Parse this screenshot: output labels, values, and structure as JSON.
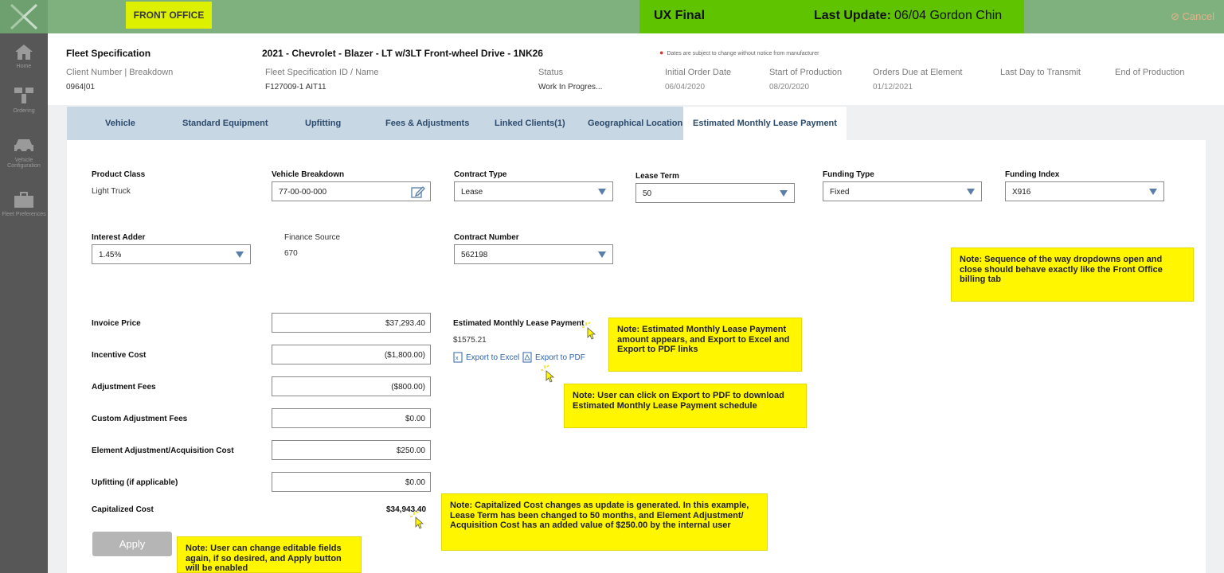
{
  "topbar": {
    "front_office": "FRONT OFFICE",
    "ux_final": "UX Final",
    "last_update_label": "Last Update:",
    "last_update_value": "06/04   Gordon Chin",
    "cancel": "Cancel"
  },
  "sidebar": {
    "items": [
      {
        "label": "Home",
        "icon": "home-icon"
      },
      {
        "label": "Ordering",
        "icon": "ordering-icon"
      },
      {
        "label": "Vehicle Configuration",
        "icon": "car-icon"
      },
      {
        "label": "Fleet Preferences",
        "icon": "briefcase-icon"
      }
    ]
  },
  "header": {
    "fleet_spec_label": "Fleet Specification",
    "vehicle_title": "2021 - Chevrolet - Blazer - LT w/3LT Front-wheel Drive - 1NK26",
    "disclaimer": "Dates are subject to change without notice from manufacturer",
    "client_label": "Client Number | Breakdown",
    "client_value": "0964|01",
    "spec_id_label": "Fleet Specification ID / Name",
    "spec_id_value": "F127009-1 AIT11",
    "status_label": "Status",
    "status_value": "Work In Progres...",
    "initial_order_label": "Initial Order Date",
    "initial_order_value": "06/04/2020",
    "start_prod_label": "Start of Production",
    "start_prod_value": "08/20/2020",
    "orders_due_label": "Orders Due at Element",
    "orders_due_value": "01/12/2021",
    "last_day_label": "Last Day to Transmit",
    "end_prod_label": "End of Production"
  },
  "tabs": [
    "Vehicle",
    "Standard Equipment",
    "Upfitting",
    "Fees & Adjustments",
    "Linked Clients(1)",
    "Geographical Location",
    "Estimated Monthly Lease Payment"
  ],
  "form": {
    "product_class_label": "Product Class",
    "product_class_value": "Light Truck",
    "vehicle_breakdown_label": "Vehicle Breakdown",
    "vehicle_breakdown_value": "77-00-00-000",
    "contract_type_label": "Contract Type",
    "contract_type_value": "Lease",
    "lease_term_label": "Lease Term",
    "lease_term_value": "50",
    "funding_type_label": "Funding Type",
    "funding_type_value": "Fixed",
    "funding_index_label": "Funding Index",
    "funding_index_value": "X916",
    "interest_adder_label": "Interest Adder",
    "interest_adder_value": "1.45%",
    "finance_source_label": "Finance Source",
    "finance_source_value": "670",
    "contract_number_label": "Contract Number",
    "contract_number_value": "562198"
  },
  "costs": {
    "invoice_price_label": "Invoice Price",
    "invoice_price_value": "$37,293.40",
    "incentive_cost_label": "Incentive Cost",
    "incentive_cost_value": "($1,800.00)",
    "adjustment_fees_label": "Adjustment Fees",
    "adjustment_fees_value": "($800.00)",
    "custom_adj_label": "Custom Adjustment Fees",
    "custom_adj_value": "$0.00",
    "element_adj_label": "Element Adjustment/Acquisition Cost",
    "element_adj_value": "$250.00",
    "upfitting_label": "Upfitting (if applicable)",
    "upfitting_value": "$0.00",
    "capitalized_label": "Capitalized Cost",
    "capitalized_value": "$34,943.40"
  },
  "estimate": {
    "label": "Estimated Monthly Lease Payment",
    "value": "$1575.21",
    "export_excel": "Export to Excel",
    "export_pdf": "Export to PDF"
  },
  "apply_label": "Apply",
  "notes": {
    "dropdowns": "Note: Sequence of the way dropdowns open and close should behave exactly like the Front Office billing tab",
    "estimate": "Note: Estimated Monthly Lease Payment amount appears, and Export to Excel and Export to PDF links",
    "pdf": "Note: User can click on Export to PDF to download Estimated Monthly Lease Payment schedule",
    "capitalized": "Note: Capitalized Cost changes as update is generated. In this example, Lease Term has been changed to 50 months, and Element Adjustment/ Acquisition Cost has an added value of $250.00 by the internal user",
    "apply": "Note: User can change editable fields again, if so desired, and Apply button will be enabled"
  }
}
